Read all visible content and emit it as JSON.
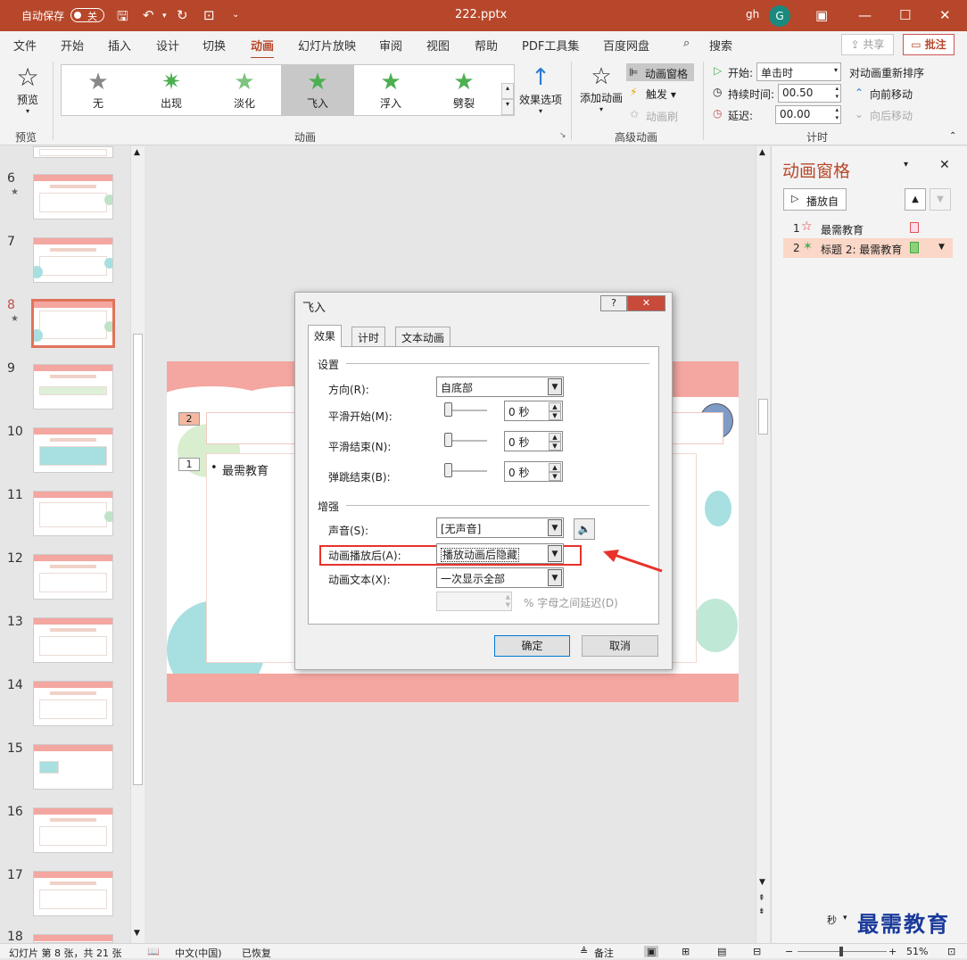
{
  "titlebar": {
    "autosave_label": "自动保存",
    "autosave_state": "关",
    "filename": "222.pptx",
    "user": "gh",
    "avatar_letter": "G",
    "minimize": "—",
    "maximize": "☐",
    "close": "✕"
  },
  "tabs": [
    "文件",
    "开始",
    "插入",
    "设计",
    "切换",
    "动画",
    "幻灯片放映",
    "审阅",
    "视图",
    "帮助",
    "PDF工具集",
    "百度网盘"
  ],
  "active_tab": "动画",
  "search_label": "搜索",
  "share_label": "共享",
  "comment_label": "批注",
  "ribbon": {
    "preview_label": "预览",
    "preview_group": "预览",
    "effects": [
      "无",
      "出现",
      "淡化",
      "飞入",
      "浮入",
      "劈裂"
    ],
    "selected_effect": "飞入",
    "effect_options": "效果选项",
    "animation_group": "动画",
    "add_animation": "添加动画",
    "animation_pane_btn": "动画窗格",
    "trigger": "触发",
    "animation_painter": "动画刷",
    "advanced_group": "高级动画",
    "start_label": "开始:",
    "start_value": "单击时",
    "duration_label": "持续时间:",
    "duration_value": "00.50",
    "delay_label": "延迟:",
    "delay_value": "00.00",
    "reorder_label": "对动画重新排序",
    "move_earlier": "向前移动",
    "move_later": "向后移动",
    "timing_group": "计时"
  },
  "thumbnails": [
    {
      "num": "6",
      "star": true
    },
    {
      "num": "7",
      "star": false
    },
    {
      "num": "8",
      "star": true,
      "current": true
    },
    {
      "num": "9",
      "star": false
    },
    {
      "num": "10",
      "star": false
    },
    {
      "num": "11",
      "star": false
    },
    {
      "num": "12",
      "star": false
    },
    {
      "num": "13",
      "star": false
    },
    {
      "num": "14",
      "star": false
    },
    {
      "num": "15",
      "star": false
    },
    {
      "num": "16",
      "star": false
    },
    {
      "num": "17",
      "star": false
    },
    {
      "num": "18",
      "star": false
    }
  ],
  "slide": {
    "tag2": "2",
    "tag1": "1",
    "bullet": "最需教育"
  },
  "anipane": {
    "title": "动画窗格",
    "play_label": "播放自",
    "items": [
      {
        "num": "1",
        "label": "最需教育"
      },
      {
        "num": "2",
        "label": "标题 2: 最需教育"
      }
    ]
  },
  "dialog": {
    "title": "飞入",
    "help": "?",
    "close": "✕",
    "tabs": [
      "效果",
      "计时",
      "文本动画"
    ],
    "settings_header": "设置",
    "direction_label": "方向(R):",
    "direction_value": "自底部",
    "smooth_start_label": "平滑开始(M):",
    "smooth_start_value": "0 秒",
    "smooth_end_label": "平滑结束(N):",
    "smooth_end_value": "0 秒",
    "bounce_end_label": "弹跳结束(B):",
    "bounce_end_value": "0 秒",
    "enhance_header": "增强",
    "sound_label": "声音(S):",
    "sound_value": "[无声音]",
    "after_label": "动画播放后(A):",
    "after_value": "播放动画后隐藏",
    "text_label": "动画文本(X):",
    "text_value": "一次显示全部",
    "letter_delay": "% 字母之间延迟(D)",
    "ok": "确定",
    "cancel": "取消"
  },
  "status": {
    "slide_info": "幻灯片 第 8 张，共 21 张",
    "language": "中文(中国)",
    "recovered": "已恢复",
    "notes": "备注",
    "zoom": "51%",
    "seconds_label": "秒"
  },
  "watermark": "最需教育",
  "colors": {
    "accent": "#b7472a",
    "highlight": "#e8322a"
  }
}
